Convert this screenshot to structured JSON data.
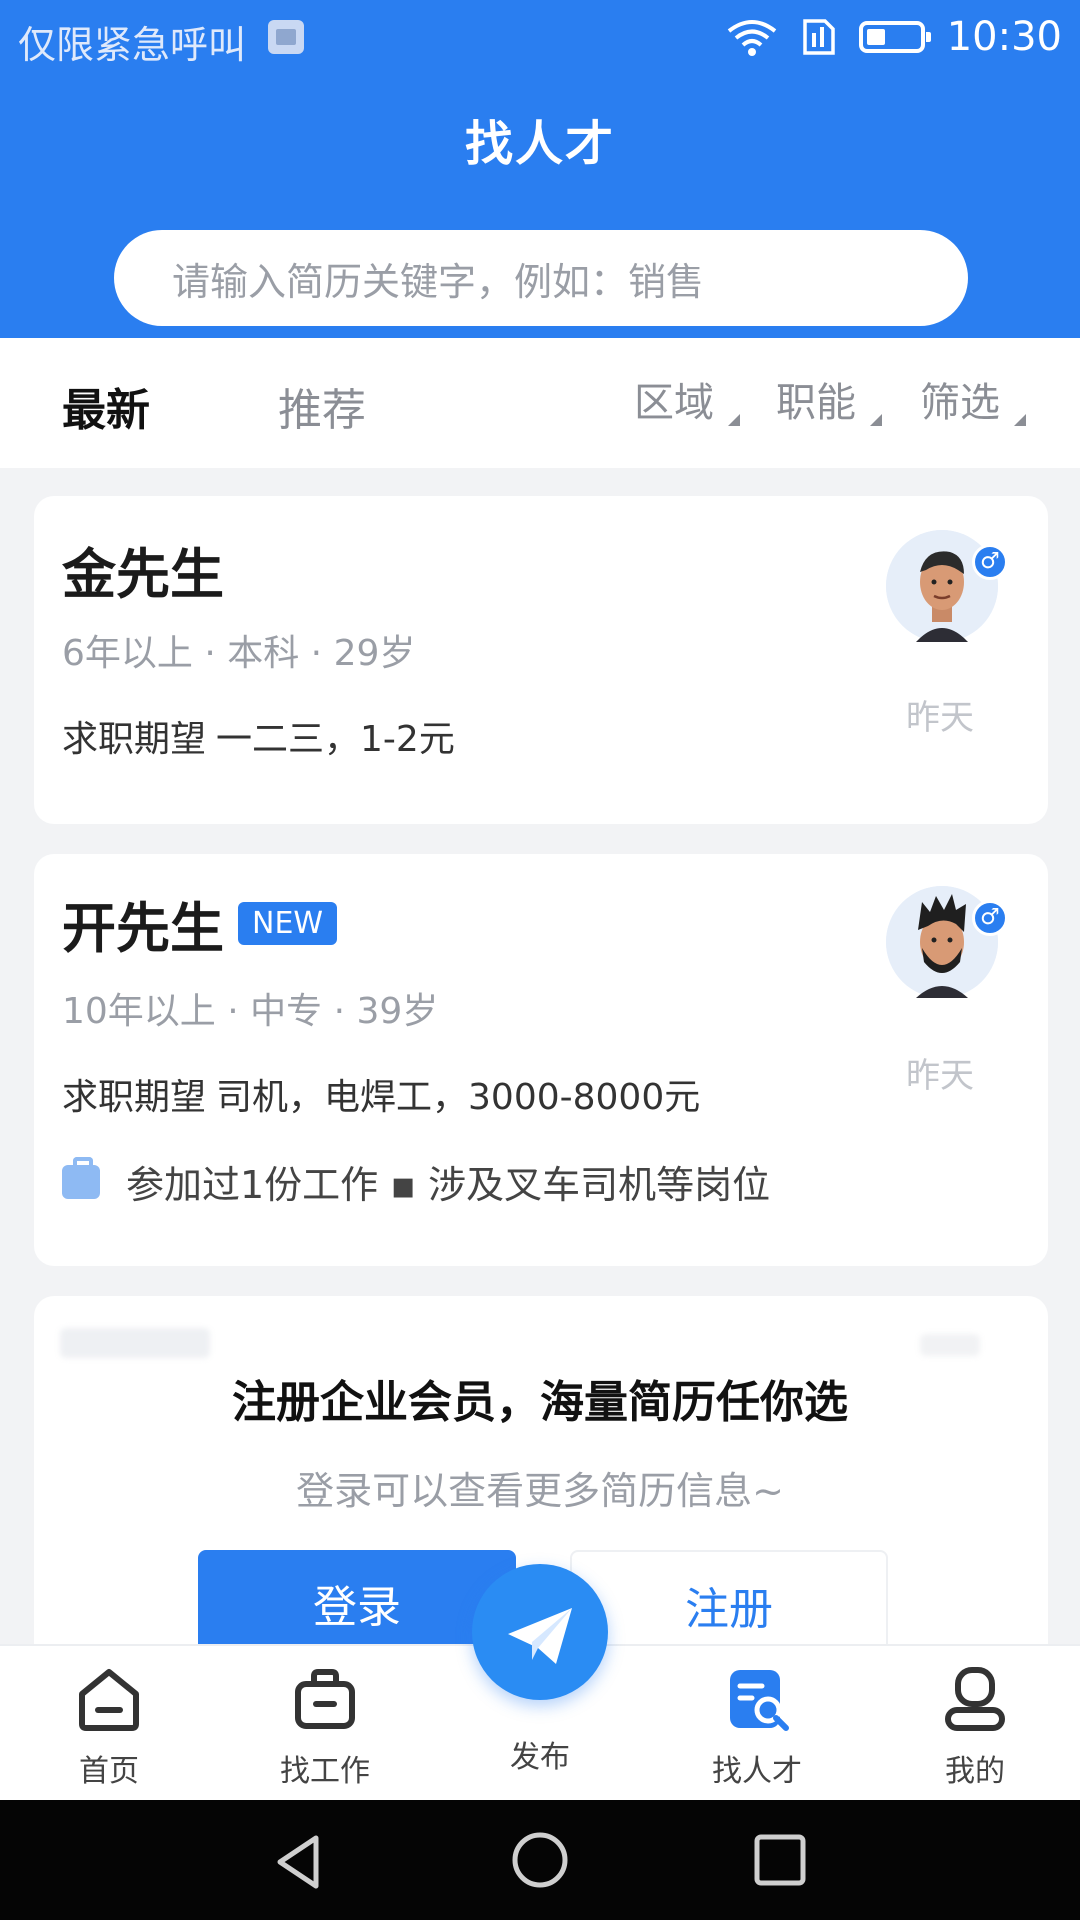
{
  "status_bar": {
    "carrier": "仅限紧急呼叫",
    "time": "10:30"
  },
  "header": {
    "title": "找人才",
    "search_placeholder": "请输入简历关键字，例如：销售"
  },
  "filter_bar": {
    "tabs": [
      {
        "label": "最新",
        "active": true
      },
      {
        "label": "推荐",
        "active": false
      }
    ],
    "filters": [
      "区域",
      "职能",
      "筛选"
    ]
  },
  "candidates": [
    {
      "name": "金先生",
      "is_new": false,
      "meta": "6年以上 · 本科 · 29岁",
      "expect_label": "求职期望",
      "expect_value": "一二三，1-2元",
      "date": "昨天",
      "gender_symbol": "♂"
    },
    {
      "name": "开先生",
      "is_new": true,
      "new_label": "NEW",
      "meta": "10年以上 · 中专 · 39岁",
      "expect_label": "求职期望",
      "expect_value": "司机，电焊工，3000-8000元",
      "date": "昨天",
      "gender_symbol": "♂",
      "experience": "参加过1份工作 ▪ 涉及叉车司机等岗位"
    }
  ],
  "login_prompt": {
    "title": "注册企业会员，海量简历任你选",
    "subtitle": "登录可以查看更多简历信息~",
    "login_label": "登录",
    "register_label": "注册"
  },
  "bottom_nav": {
    "items": [
      {
        "label": "首页",
        "icon": "home-icon"
      },
      {
        "label": "找工作",
        "icon": "briefcase-icon"
      },
      {
        "label": "发布",
        "icon": "paper-plane-icon"
      },
      {
        "label": "找人才",
        "icon": "resume-search-icon",
        "active": true
      },
      {
        "label": "我的",
        "icon": "user-icon"
      }
    ]
  },
  "colors": {
    "primary": "#2a7ef0",
    "background": "#f2f3f5"
  }
}
